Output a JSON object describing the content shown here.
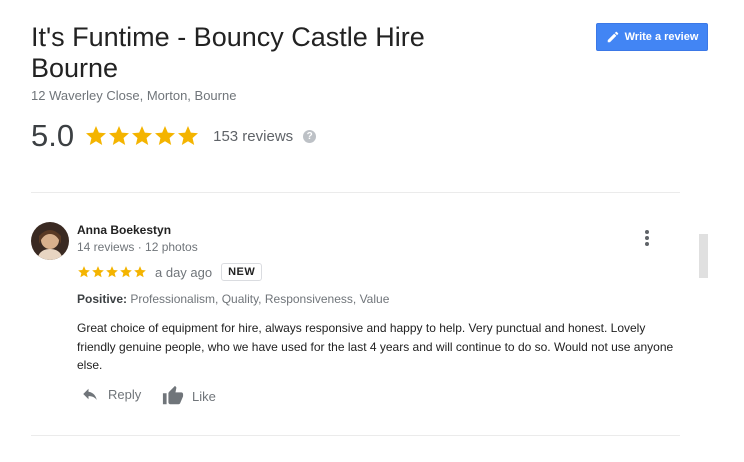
{
  "business": {
    "title": "It's Funtime - Bouncy Castle Hire Bourne",
    "address": "12 Waverley Close, Morton, Bourne",
    "rating": "5.0",
    "stars": 5,
    "review_count": "153 reviews",
    "help": "?"
  },
  "write_review": {
    "label": "Write a review",
    "icon": "pencil-icon"
  },
  "review": {
    "author": "Anna Boekestyn",
    "meta": "14 reviews · 12 photos",
    "stars": 5,
    "time": "a day ago",
    "badge": "NEW",
    "positive_label": "Positive:",
    "positive_values": "Professionalism, Quality, Responsiveness, Value",
    "text": "Great choice of equipment for hire, always responsive and happy to help.  Very punctual and honest. Lovely friendly genuine people, who we have used for the last 4 years and will continue to do so. Would not use anyone else.",
    "actions": {
      "reply": "Reply",
      "like": "Like"
    }
  },
  "colors": {
    "accent": "#4285f4",
    "star": "#f4b400"
  }
}
